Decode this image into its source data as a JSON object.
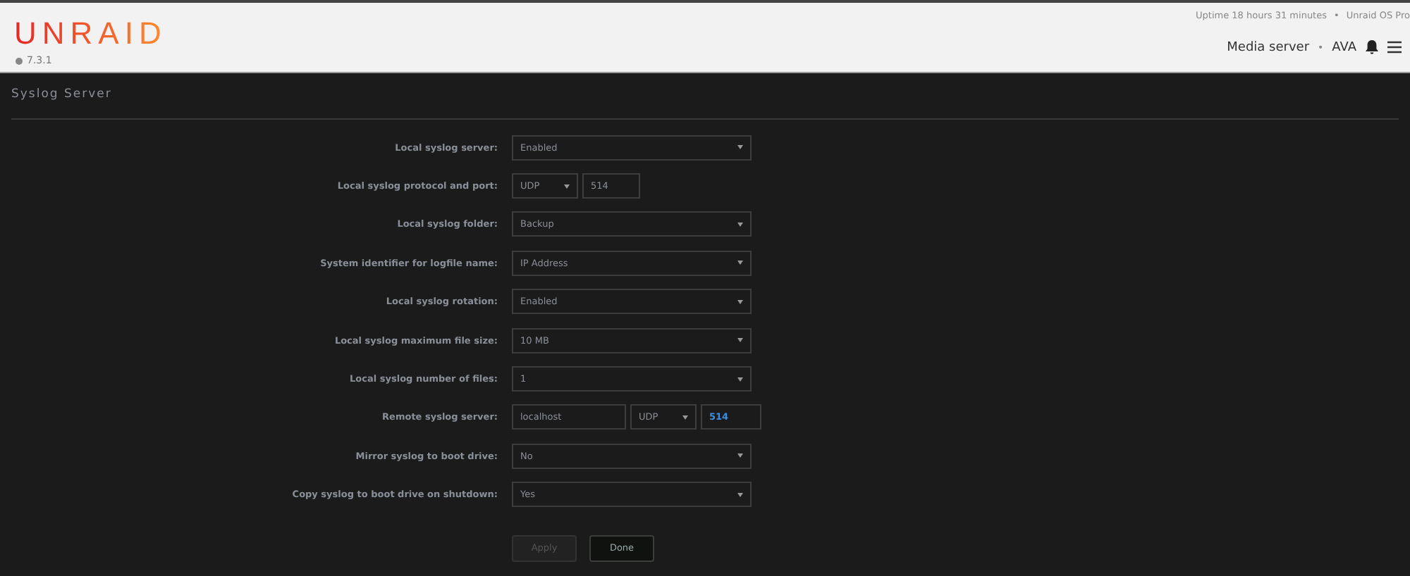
{
  "header": {
    "logo": "UNRAID",
    "version": "7.3.1",
    "uptime": "Uptime 18 hours 31 minutes",
    "separator": "•",
    "os": "Unraid OS Pro",
    "server": "Media server",
    "server_separator": "•",
    "user": "AVA"
  },
  "section": {
    "title": "Syslog Server"
  },
  "rows": [
    {
      "label": "Local syslog server:",
      "controls": [
        {
          "kind": "select",
          "value": "Enabled"
        }
      ]
    },
    {
      "label": "Local syslog protocol and port:",
      "controls": [
        {
          "kind": "select",
          "value": "UDP"
        },
        {
          "kind": "input",
          "value": "514",
          "highlighted": false
        }
      ]
    },
    {
      "label": "Local syslog folder:",
      "controls": [
        {
          "kind": "select",
          "value": "Backup"
        }
      ]
    },
    {
      "label": "System identifier for logfile name:",
      "controls": [
        {
          "kind": "select",
          "value": "IP Address"
        }
      ]
    },
    {
      "label": "Local syslog rotation:",
      "controls": [
        {
          "kind": "select",
          "value": "Enabled"
        }
      ]
    },
    {
      "label": "Local syslog maximum file size:",
      "controls": [
        {
          "kind": "select",
          "value": "10 MB"
        }
      ]
    },
    {
      "label": "Local syslog number of files:",
      "controls": [
        {
          "kind": "select",
          "value": "1"
        }
      ]
    },
    {
      "label": "Remote syslog server:",
      "controls": [
        {
          "kind": "input",
          "value": "localhost",
          "highlighted": false
        },
        {
          "kind": "select",
          "value": "UDP"
        },
        {
          "kind": "input",
          "value": "514",
          "highlighted": true
        }
      ]
    },
    {
      "label": "Mirror syslog to boot drive:",
      "controls": [
        {
          "kind": "select",
          "value": "No"
        }
      ]
    },
    {
      "label": "Copy syslog to boot drive on shutdown:",
      "controls": [
        {
          "kind": "select",
          "value": "Yes"
        }
      ]
    }
  ],
  "buttons": [
    {
      "label": "Apply",
      "disabled": true
    },
    {
      "label": "Done",
      "disabled": false
    }
  ]
}
